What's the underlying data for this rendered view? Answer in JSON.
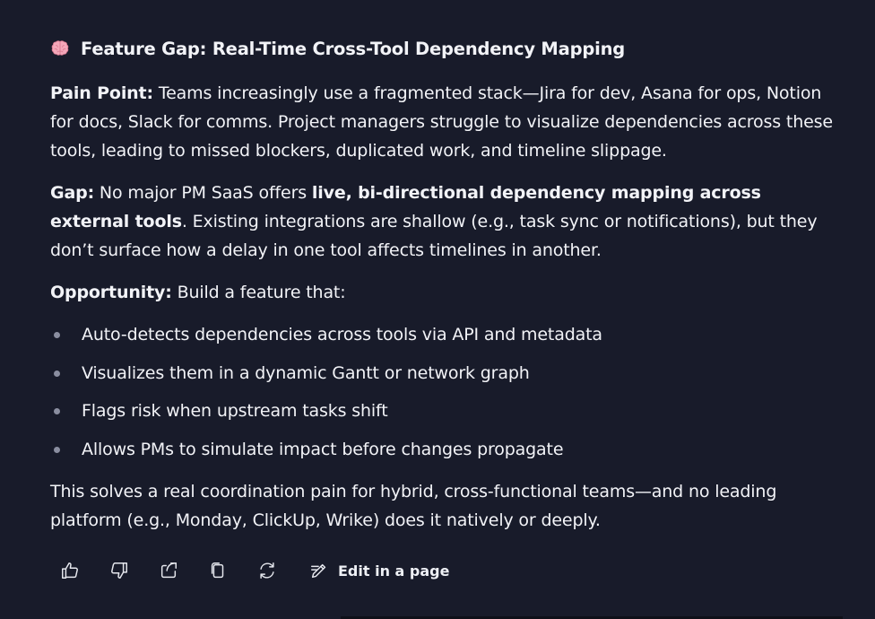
{
  "heading": {
    "icon": "brain-emoji-icon",
    "text": "Feature Gap: Real-Time Cross-Tool Dependency Mapping"
  },
  "pain_point": {
    "label": "Pain Point:",
    "text": " Teams increasingly use a fragmented stack—Jira for dev, Asana for ops, Notion for docs, Slack for comms. Project managers struggle to visualize dependencies across these tools, leading to missed blockers, duplicated work, and timeline slippage."
  },
  "gap": {
    "label": "Gap:",
    "text_before": " No major PM SaaS offers ",
    "bold": "live, bi-directional dependency mapping across external tools",
    "text_after": ". Existing integrations are shallow (e.g., task sync or notifications), but they don’t surface how a delay in one tool affects timelines in another."
  },
  "opportunity": {
    "label": "Opportunity:",
    "text": " Build a feature that:"
  },
  "bullets": [
    "Auto-detects dependencies across tools via API and metadata",
    "Visualizes them in a dynamic Gantt or network graph",
    "Flags risk when upstream tasks shift",
    "Allows PMs to simulate impact before changes propagate"
  ],
  "conclusion": "This solves a real coordination pain for hybrid, cross-functional teams—and no leading platform (e.g., Monday, ClickUp, Wrike) does it natively or deeply.",
  "actions": {
    "items": [
      {
        "name": "thumbs-up-button",
        "icon": "thumbs-up-icon"
      },
      {
        "name": "thumbs-down-button",
        "icon": "thumbs-down-icon"
      },
      {
        "name": "share-button",
        "icon": "share-icon"
      },
      {
        "name": "copy-button",
        "icon": "copy-icon"
      },
      {
        "name": "regenerate-button",
        "icon": "refresh-icon"
      }
    ],
    "edit_label": "Edit in a page"
  },
  "colors": {
    "background": "#181b2a",
    "text": "#f2f3f7",
    "bullet": "#8a8ea0"
  }
}
